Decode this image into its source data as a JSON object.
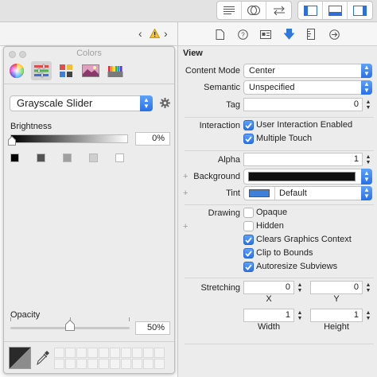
{
  "toolbar": {
    "left_group_icons": [
      "standard-editor-icon",
      "assistant-editor-icon",
      "version-editor-icon"
    ],
    "right_group_icons": [
      "navigator-toggle-icon",
      "debug-area-toggle-icon",
      "utilities-toggle-icon"
    ]
  },
  "jumpbar": {
    "icons": [
      "chevron-left-icon",
      "warning-icon",
      "chevron-right-icon"
    ]
  },
  "inspector_tabs": [
    "file-inspector-icon",
    "quick-help-icon",
    "identity-inspector-icon",
    "attributes-inspector-icon",
    "size-inspector-icon",
    "connections-inspector-icon"
  ],
  "colors_panel": {
    "title": "Colors",
    "mode": "Grayscale Slider",
    "brightness_label": "Brightness",
    "brightness_value": "0%",
    "opacity_label": "Opacity",
    "opacity_value": "50%",
    "opacity_fraction": 0.5,
    "brightness_fraction": 0.0,
    "preset_grays": [
      "#000000",
      "#545454",
      "#a0a0a0",
      "#cfcfcf",
      "#ffffff"
    ]
  },
  "inspector": {
    "section_title": "View",
    "content_mode_label": "Content Mode",
    "content_mode_value": "Center",
    "semantic_label": "Semantic",
    "semantic_value": "Unspecified",
    "tag_label": "Tag",
    "tag_value": "0",
    "interaction_label": "Interaction",
    "user_interaction_label": "User Interaction Enabled",
    "user_interaction_checked": true,
    "multiple_touch_label": "Multiple Touch",
    "multiple_touch_checked": true,
    "alpha_label": "Alpha",
    "alpha_value": "1",
    "background_label": "Background",
    "background_color": "#111111",
    "tint_label": "Tint",
    "tint_value": "Default",
    "tint_color": "#3d7fd9",
    "drawing_label": "Drawing",
    "opaque_label": "Opaque",
    "opaque_checked": false,
    "hidden_label": "Hidden",
    "hidden_checked": false,
    "clears_label": "Clears Graphics Context",
    "clears_checked": true,
    "clip_label": "Clip to Bounds",
    "clip_checked": true,
    "autoresize_label": "Autoresize Subviews",
    "autoresize_checked": true,
    "stretching_label": "Stretching",
    "stretch_x_value": "0",
    "stretch_y_value": "0",
    "stretch_w_value": "1",
    "stretch_h_value": "1",
    "x_label": "X",
    "y_label": "Y",
    "width_label": "Width",
    "height_label": "Height"
  }
}
